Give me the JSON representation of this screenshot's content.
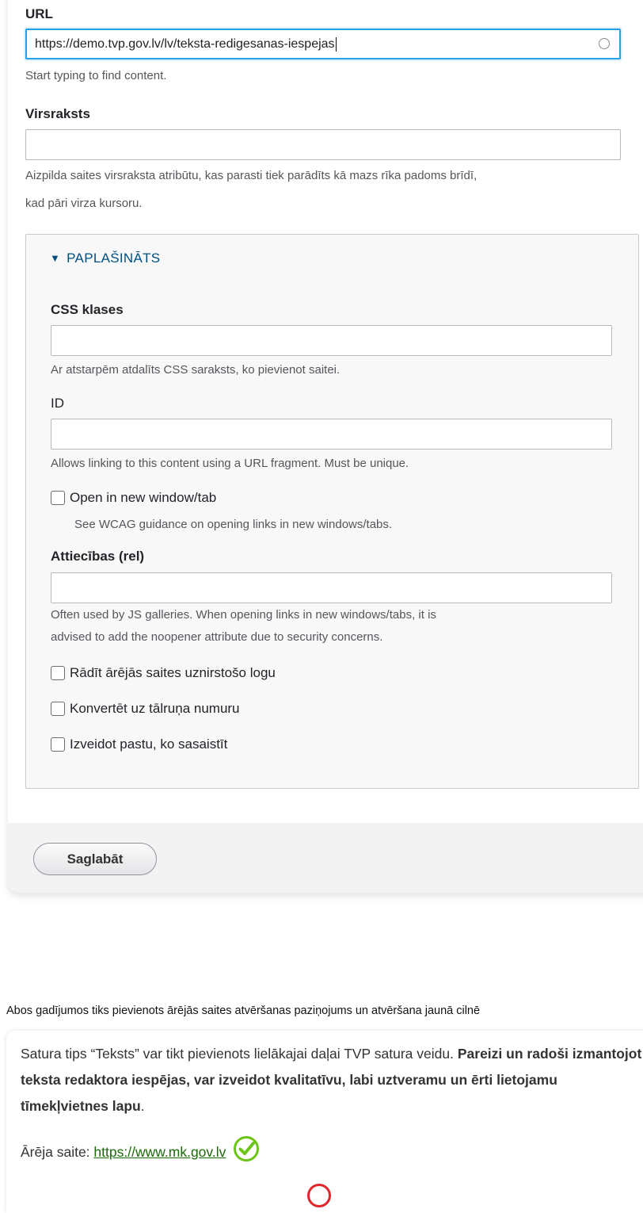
{
  "form": {
    "url": {
      "label": "URL",
      "value": "https://demo.tvp.gov.lv/lv/teksta-redigesanas-iespejas",
      "help": "Start typing to find content."
    },
    "title": {
      "label": "Virsraksts",
      "value": "",
      "help_line1": "Aizpilda saites virsraksta atribūtu, kas parasti tiek parādīts kā mazs rīka padoms brīdī,",
      "help_line2": "kad pāri virza kursoru."
    },
    "advanced": {
      "summary": "PAPLAŠINĀTS",
      "css_classes": {
        "label": "CSS klases",
        "help": "Ar atstarpēm atdalīts CSS saraksts, ko pievienot saitei."
      },
      "id": {
        "label": "ID",
        "help": "Allows linking to this content using a URL fragment. Must be unique."
      },
      "new_window": {
        "label": "Open in new window/tab",
        "help": "See WCAG guidance on opening links in new windows/tabs."
      },
      "rel": {
        "label": "Attiecības (rel)",
        "help_line1": "Often used by JS galleries. When opening links in new windows/tabs, it is",
        "help_line2": "advised to add the noopener attribute due to security concerns."
      },
      "checkboxes": [
        "Rādīt ārējās saites uznirstošo logu",
        "Konvertēt uz tālruņa numuru",
        "Izveidot pastu, ko sasaistīt"
      ]
    },
    "save_label": "Saglabāt"
  },
  "notice": "Abos gadījumos tiks pievienots ārējās saites atvēršanas paziņojums un atvēršana jaunā cilnē",
  "preview": {
    "para_plain": "Satura tips “Teksts” var tikt pievienots lielākajai daļai TVP satura veidu.",
    "para_bold1": "Pareizi un",
    "para_bold2": "radoši izmantojot teksta redaktora iespējas, var izveidot kvalitatīvu, labi uztveramu",
    "para_bold3": "un ērti lietojamu tīmekļvietnes lapu",
    "para_end": ".",
    "link_label": "Ārēja saite:",
    "link_text": "https://www.mk.gov.lv"
  },
  "colors": {
    "accent": "#26a0e3",
    "summary": "#004f80",
    "link": "#1b6a0a",
    "ok_icon": "#6cc417",
    "error": "#e0262b"
  }
}
